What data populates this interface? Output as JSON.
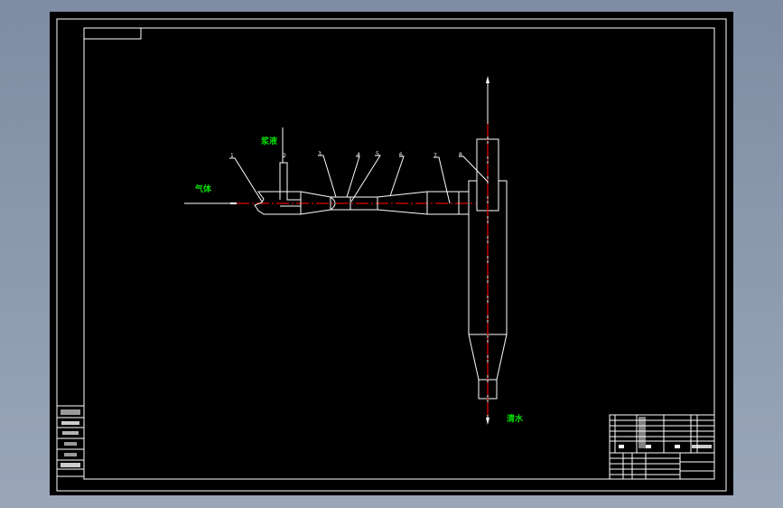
{
  "labels": {
    "gas": "气体",
    "slurry": "浆液",
    "water": "清水"
  },
  "part_numbers": [
    "1",
    "2",
    "3",
    "4",
    "5",
    "6",
    "7",
    "8"
  ],
  "colors": {
    "sheet": "#000000",
    "lines": "#ffffff",
    "centerline": "#e00000",
    "annotation": "#00e000"
  },
  "left_table": {
    "rows": [
      "",
      "",
      "",
      "",
      "",
      "",
      ""
    ]
  },
  "title_block": {
    "rows": [
      "",
      "",
      "",
      "",
      "",
      ""
    ]
  }
}
